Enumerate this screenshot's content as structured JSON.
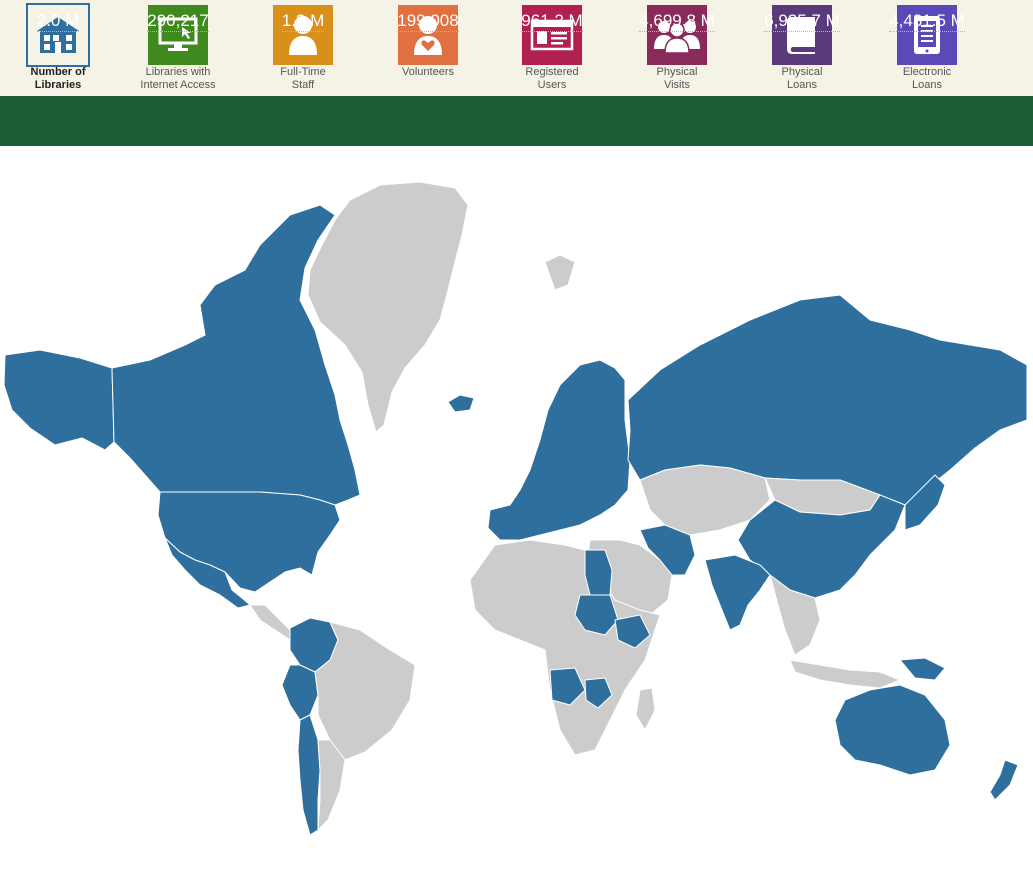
{
  "metrics": [
    {
      "key": "libraries",
      "label": "Number of\nLibraries",
      "value": "2.0 M",
      "icon": "library-building-icon",
      "color": "#ffffff",
      "active": true
    },
    {
      "key": "internet",
      "label": "Libraries with\nInternet Access",
      "value": "290,217",
      "icon": "computer-monitor-icon",
      "color": "#3f8a1f",
      "active": false
    },
    {
      "key": "staff",
      "label": "Full-Time\nStaff",
      "value": "1.3 M",
      "icon": "staff-person-icon",
      "color": "#d9901a",
      "active": false
    },
    {
      "key": "volunteers",
      "label": "Volunteers",
      "value": "199,008",
      "icon": "volunteer-heart-icon",
      "color": "#e07040",
      "active": false
    },
    {
      "key": "users",
      "label": "Registered\nUsers",
      "value": "961.2 M",
      "icon": "id-card-icon",
      "color": "#b02050",
      "active": false
    },
    {
      "key": "visits",
      "label": "Physical\nVisits",
      "value": "4,699.8 M",
      "icon": "people-group-icon",
      "color": "#8a2a5a",
      "active": false
    },
    {
      "key": "loans",
      "label": "Physical\nLoans",
      "value": "6,935.7 M",
      "icon": "book-icon",
      "color": "#5a3a7a",
      "active": false
    },
    {
      "key": "eloans",
      "label": "Electronic\nLoans",
      "value": "4,431.5 M",
      "icon": "tablet-icon",
      "color": "#5a4ab8",
      "active": false
    }
  ],
  "colors": {
    "data_available": "#2e6f9e",
    "no_data": "#cccccc",
    "ocean": "#ffffff",
    "stats_bar": "#1a5c35",
    "top_bar": "#f5f3e6"
  },
  "regions": [
    {
      "name": "Canada",
      "has_data": true
    },
    {
      "name": "Alaska",
      "has_data": true
    },
    {
      "name": "United States",
      "has_data": true
    },
    {
      "name": "Mexico",
      "has_data": true
    },
    {
      "name": "Greenland",
      "has_data": false
    },
    {
      "name": "Iceland",
      "has_data": true
    },
    {
      "name": "Central America",
      "has_data": false
    },
    {
      "name": "Colombia",
      "has_data": true
    },
    {
      "name": "Peru",
      "has_data": true
    },
    {
      "name": "Chile",
      "has_data": true
    },
    {
      "name": "Brazil",
      "has_data": false
    },
    {
      "name": "South America Other",
      "has_data": false
    },
    {
      "name": "Europe",
      "has_data": true
    },
    {
      "name": "Russia",
      "has_data": true
    },
    {
      "name": "Central Asia",
      "has_data": false
    },
    {
      "name": "Middle East",
      "has_data": false
    },
    {
      "name": "Iran",
      "has_data": true
    },
    {
      "name": "India",
      "has_data": true
    },
    {
      "name": "China",
      "has_data": true
    },
    {
      "name": "Mongolia",
      "has_data": false
    },
    {
      "name": "Japan",
      "has_data": true
    },
    {
      "name": "Southeast Asia",
      "has_data": false
    },
    {
      "name": "Indonesia",
      "has_data": false
    },
    {
      "name": "Australia",
      "has_data": true
    },
    {
      "name": "New Zealand",
      "has_data": true
    },
    {
      "name": "Papua New Guinea",
      "has_data": true
    },
    {
      "name": "Africa",
      "has_data": false
    },
    {
      "name": "Egypt",
      "has_data": true
    },
    {
      "name": "Sudan",
      "has_data": true
    },
    {
      "name": "Ethiopia",
      "has_data": true
    },
    {
      "name": "Angola",
      "has_data": true
    },
    {
      "name": "Zambia",
      "has_data": true
    },
    {
      "name": "Madagascar",
      "has_data": false
    },
    {
      "name": "Svalbard",
      "has_data": false
    }
  ]
}
